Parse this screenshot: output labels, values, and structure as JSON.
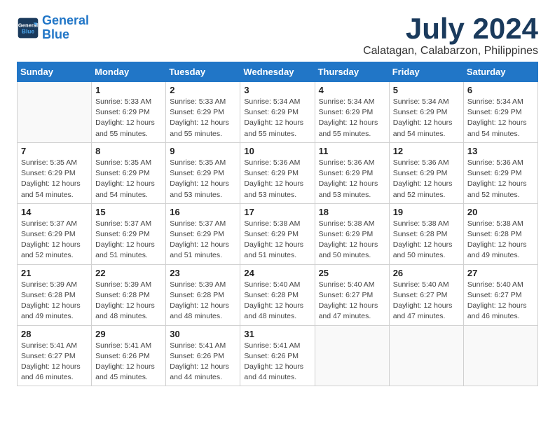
{
  "logo": {
    "line1": "General",
    "line2": "Blue"
  },
  "title": "July 2024",
  "location": "Calatagan, Calabarzon, Philippines",
  "days_header": [
    "Sunday",
    "Monday",
    "Tuesday",
    "Wednesday",
    "Thursday",
    "Friday",
    "Saturday"
  ],
  "weeks": [
    [
      {
        "num": "",
        "info": ""
      },
      {
        "num": "1",
        "info": "Sunrise: 5:33 AM\nSunset: 6:29 PM\nDaylight: 12 hours\nand 55 minutes."
      },
      {
        "num": "2",
        "info": "Sunrise: 5:33 AM\nSunset: 6:29 PM\nDaylight: 12 hours\nand 55 minutes."
      },
      {
        "num": "3",
        "info": "Sunrise: 5:34 AM\nSunset: 6:29 PM\nDaylight: 12 hours\nand 55 minutes."
      },
      {
        "num": "4",
        "info": "Sunrise: 5:34 AM\nSunset: 6:29 PM\nDaylight: 12 hours\nand 55 minutes."
      },
      {
        "num": "5",
        "info": "Sunrise: 5:34 AM\nSunset: 6:29 PM\nDaylight: 12 hours\nand 54 minutes."
      },
      {
        "num": "6",
        "info": "Sunrise: 5:34 AM\nSunset: 6:29 PM\nDaylight: 12 hours\nand 54 minutes."
      }
    ],
    [
      {
        "num": "7",
        "info": "Sunrise: 5:35 AM\nSunset: 6:29 PM\nDaylight: 12 hours\nand 54 minutes."
      },
      {
        "num": "8",
        "info": "Sunrise: 5:35 AM\nSunset: 6:29 PM\nDaylight: 12 hours\nand 54 minutes."
      },
      {
        "num": "9",
        "info": "Sunrise: 5:35 AM\nSunset: 6:29 PM\nDaylight: 12 hours\nand 53 minutes."
      },
      {
        "num": "10",
        "info": "Sunrise: 5:36 AM\nSunset: 6:29 PM\nDaylight: 12 hours\nand 53 minutes."
      },
      {
        "num": "11",
        "info": "Sunrise: 5:36 AM\nSunset: 6:29 PM\nDaylight: 12 hours\nand 53 minutes."
      },
      {
        "num": "12",
        "info": "Sunrise: 5:36 AM\nSunset: 6:29 PM\nDaylight: 12 hours\nand 52 minutes."
      },
      {
        "num": "13",
        "info": "Sunrise: 5:36 AM\nSunset: 6:29 PM\nDaylight: 12 hours\nand 52 minutes."
      }
    ],
    [
      {
        "num": "14",
        "info": "Sunrise: 5:37 AM\nSunset: 6:29 PM\nDaylight: 12 hours\nand 52 minutes."
      },
      {
        "num": "15",
        "info": "Sunrise: 5:37 AM\nSunset: 6:29 PM\nDaylight: 12 hours\nand 51 minutes."
      },
      {
        "num": "16",
        "info": "Sunrise: 5:37 AM\nSunset: 6:29 PM\nDaylight: 12 hours\nand 51 minutes."
      },
      {
        "num": "17",
        "info": "Sunrise: 5:38 AM\nSunset: 6:29 PM\nDaylight: 12 hours\nand 51 minutes."
      },
      {
        "num": "18",
        "info": "Sunrise: 5:38 AM\nSunset: 6:29 PM\nDaylight: 12 hours\nand 50 minutes."
      },
      {
        "num": "19",
        "info": "Sunrise: 5:38 AM\nSunset: 6:28 PM\nDaylight: 12 hours\nand 50 minutes."
      },
      {
        "num": "20",
        "info": "Sunrise: 5:38 AM\nSunset: 6:28 PM\nDaylight: 12 hours\nand 49 minutes."
      }
    ],
    [
      {
        "num": "21",
        "info": "Sunrise: 5:39 AM\nSunset: 6:28 PM\nDaylight: 12 hours\nand 49 minutes."
      },
      {
        "num": "22",
        "info": "Sunrise: 5:39 AM\nSunset: 6:28 PM\nDaylight: 12 hours\nand 48 minutes."
      },
      {
        "num": "23",
        "info": "Sunrise: 5:39 AM\nSunset: 6:28 PM\nDaylight: 12 hours\nand 48 minutes."
      },
      {
        "num": "24",
        "info": "Sunrise: 5:40 AM\nSunset: 6:28 PM\nDaylight: 12 hours\nand 48 minutes."
      },
      {
        "num": "25",
        "info": "Sunrise: 5:40 AM\nSunset: 6:27 PM\nDaylight: 12 hours\nand 47 minutes."
      },
      {
        "num": "26",
        "info": "Sunrise: 5:40 AM\nSunset: 6:27 PM\nDaylight: 12 hours\nand 47 minutes."
      },
      {
        "num": "27",
        "info": "Sunrise: 5:40 AM\nSunset: 6:27 PM\nDaylight: 12 hours\nand 46 minutes."
      }
    ],
    [
      {
        "num": "28",
        "info": "Sunrise: 5:41 AM\nSunset: 6:27 PM\nDaylight: 12 hours\nand 46 minutes."
      },
      {
        "num": "29",
        "info": "Sunrise: 5:41 AM\nSunset: 6:26 PM\nDaylight: 12 hours\nand 45 minutes."
      },
      {
        "num": "30",
        "info": "Sunrise: 5:41 AM\nSunset: 6:26 PM\nDaylight: 12 hours\nand 44 minutes."
      },
      {
        "num": "31",
        "info": "Sunrise: 5:41 AM\nSunset: 6:26 PM\nDaylight: 12 hours\nand 44 minutes."
      },
      {
        "num": "",
        "info": ""
      },
      {
        "num": "",
        "info": ""
      },
      {
        "num": "",
        "info": ""
      }
    ]
  ]
}
